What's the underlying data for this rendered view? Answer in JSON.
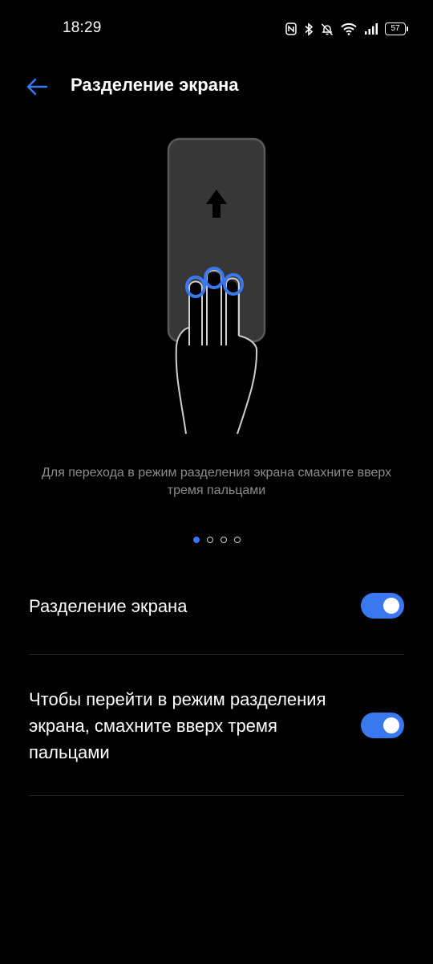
{
  "status_bar": {
    "time": "18:29",
    "icons": [
      "nfc-icon",
      "bluetooth-icon",
      "bell-off-icon",
      "wifi-icon",
      "signal-icon"
    ],
    "battery": "57"
  },
  "header": {
    "title": "Разделение экрана",
    "back_icon": "arrow-left-icon"
  },
  "illustration": {
    "icon": "three-finger-swipe-up-icon"
  },
  "caption": "Для перехода в режим разделения экрана смахните вверх тремя пальцами",
  "pager": {
    "count": 4,
    "active_index": 0
  },
  "settings": [
    {
      "label": "Разделение экрана",
      "enabled": true
    },
    {
      "label": "Чтобы перейти в режим разделения экрана, смахните вверх тремя пальцами",
      "enabled": true
    }
  ],
  "colors": {
    "background": "#000000",
    "accent": "#3a78f0",
    "caption_text": "#8c8c8c"
  }
}
